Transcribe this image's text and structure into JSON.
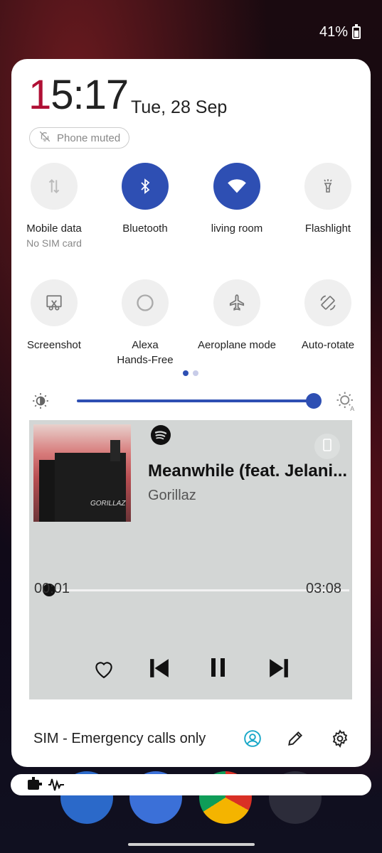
{
  "status_bar": {
    "battery": "41%"
  },
  "header": {
    "time_first_digit": "1",
    "time_rest": "5:17",
    "date": "Tue, 28 Sep",
    "ringer_status": "Phone muted"
  },
  "quick_tiles": [
    {
      "label": "Mobile data",
      "sub": "No SIM card",
      "icon": "mobile-data-icon",
      "active": false
    },
    {
      "label": "Bluetooth",
      "sub": "",
      "icon": "bluetooth-icon",
      "active": true
    },
    {
      "label": "living room",
      "sub": "",
      "icon": "wifi-icon",
      "active": true
    },
    {
      "label": "Flashlight",
      "sub": "",
      "icon": "flashlight-icon",
      "active": false
    },
    {
      "label": "Screenshot",
      "sub": "",
      "icon": "screenshot-icon",
      "active": false
    },
    {
      "label": "Alexa",
      "sub": "Hands-Free",
      "icon": "alexa-icon",
      "active": false
    },
    {
      "label": "Aeroplane mode",
      "sub": "",
      "icon": "airplane-icon",
      "active": false
    },
    {
      "label": "Auto-rotate",
      "sub": "",
      "icon": "auto-rotate-icon",
      "active": false
    }
  ],
  "pager": {
    "pages": 2,
    "current": 1
  },
  "brightness": {
    "level": 0.98
  },
  "media": {
    "app": "Spotify",
    "title": "Meanwhile (feat. Jelani...",
    "artist": "Gorillaz",
    "album_art_text": "GORILLAZ",
    "elapsed": "00:01",
    "duration": "03:08",
    "progress": 0.005
  },
  "footer": {
    "carrier_status": "SIM - Emergency calls only"
  },
  "colors": {
    "accent": "#2e4fb3",
    "clock_accent": "#b01035",
    "media_bg": "#d3d6d5"
  }
}
